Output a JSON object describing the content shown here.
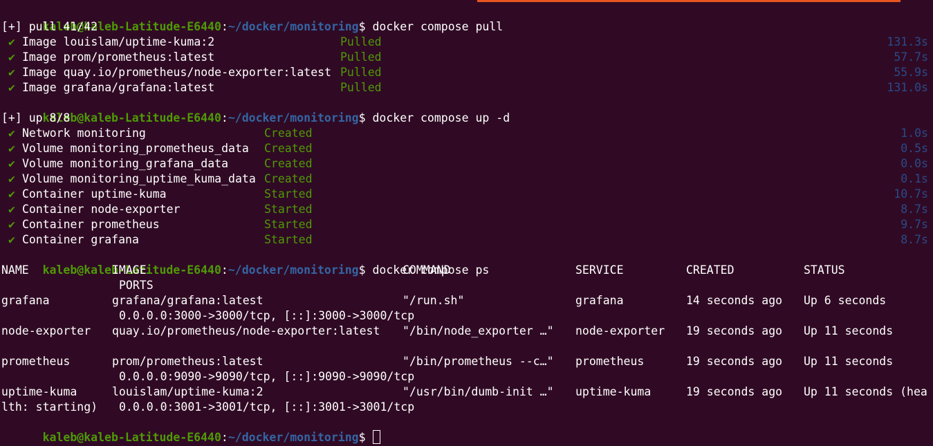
{
  "prompt": {
    "user_host": "kaleb@kaleb-Latitude-E6440",
    "colon": ":",
    "path": "~/docker/monitoring",
    "dollar": "$"
  },
  "commands": {
    "pull": "docker compose pull",
    "up": "docker compose up -d",
    "ps": "docker compose ps"
  },
  "pull": {
    "header": "[+] pull 41/42",
    "check": "✔",
    "items": [
      {
        "label": "Image louislam/uptime-kuma:2",
        "status": "Pulled",
        "time": "131.3s"
      },
      {
        "label": "Image prom/prometheus:latest",
        "status": "Pulled",
        "time": "57.7s"
      },
      {
        "label": "Image quay.io/prometheus/node-exporter:latest",
        "status": "Pulled",
        "time": "55.9s"
      },
      {
        "label": "Image grafana/grafana:latest",
        "status": "Pulled",
        "time": "131.0s"
      }
    ]
  },
  "up": {
    "header": "[+] up 8/8",
    "check": "✔",
    "items": [
      {
        "label": "Network monitoring",
        "status": "Created",
        "time": "1.0s"
      },
      {
        "label": "Volume monitoring_prometheus_data",
        "status": "Created",
        "time": "0.5s"
      },
      {
        "label": "Volume monitoring_grafana_data",
        "status": "Created",
        "time": "0.0s"
      },
      {
        "label": "Volume monitoring_uptime_kuma_data",
        "status": "Created",
        "time": "0.1s"
      },
      {
        "label": "Container uptime-kuma",
        "status": "Started",
        "time": "10.7s"
      },
      {
        "label": "Container node-exporter",
        "status": "Started",
        "time": "8.7s"
      },
      {
        "label": "Container prometheus",
        "status": "Started",
        "time": "9.7s"
      },
      {
        "label": "Container grafana",
        "status": "Started",
        "time": "8.7s"
      }
    ]
  },
  "ps": {
    "headers": {
      "name": "NAME",
      "image": "IMAGE",
      "command": "COMMAND",
      "service": "SERVICE",
      "created": "CREATED",
      "status": "STATUS",
      "ports": "PORTS"
    },
    "rows": [
      {
        "name": "grafana",
        "image": "grafana/grafana:latest",
        "command": "\"/run.sh\"",
        "service": "grafana",
        "created": "14 seconds ago",
        "status": "Up 6 seconds",
        "status_wrap": "",
        "ports": "0.0.0.0:3000->3000/tcp, [::]:3000->3000/tcp"
      },
      {
        "name": "node-exporter",
        "image": "quay.io/prometheus/node-exporter:latest",
        "command": "\"/bin/node_exporter …\"",
        "service": "node-exporter",
        "created": "19 seconds ago",
        "status": "Up 11 seconds",
        "status_wrap": "",
        "ports": ""
      },
      {
        "name": "prometheus",
        "image": "prom/prometheus:latest",
        "command": "\"/bin/prometheus --c…\"",
        "service": "prometheus",
        "created": "19 seconds ago",
        "status": "Up 11 seconds",
        "status_wrap": "",
        "ports": "0.0.0.0:9090->9090/tcp, [::]:9090->9090/tcp"
      },
      {
        "name": "uptime-kuma",
        "image": "louislam/uptime-kuma:2",
        "command": "\"/usr/bin/dumb-init …\"",
        "service": "uptime-kuma",
        "created": "19 seconds ago",
        "status": "Up 11 seconds (hea",
        "status_wrap": "lth: starting)",
        "ports": "0.0.0.0:3001->3001/tcp, [::]:3001->3001/tcp"
      }
    ]
  },
  "colors": {
    "background": "#300a24",
    "prompt_user": "#4e9a06",
    "prompt_path": "#3465a4",
    "status_green": "#4e9a06",
    "timing": "#2a4a8a",
    "accent_bar": "#e95420"
  }
}
